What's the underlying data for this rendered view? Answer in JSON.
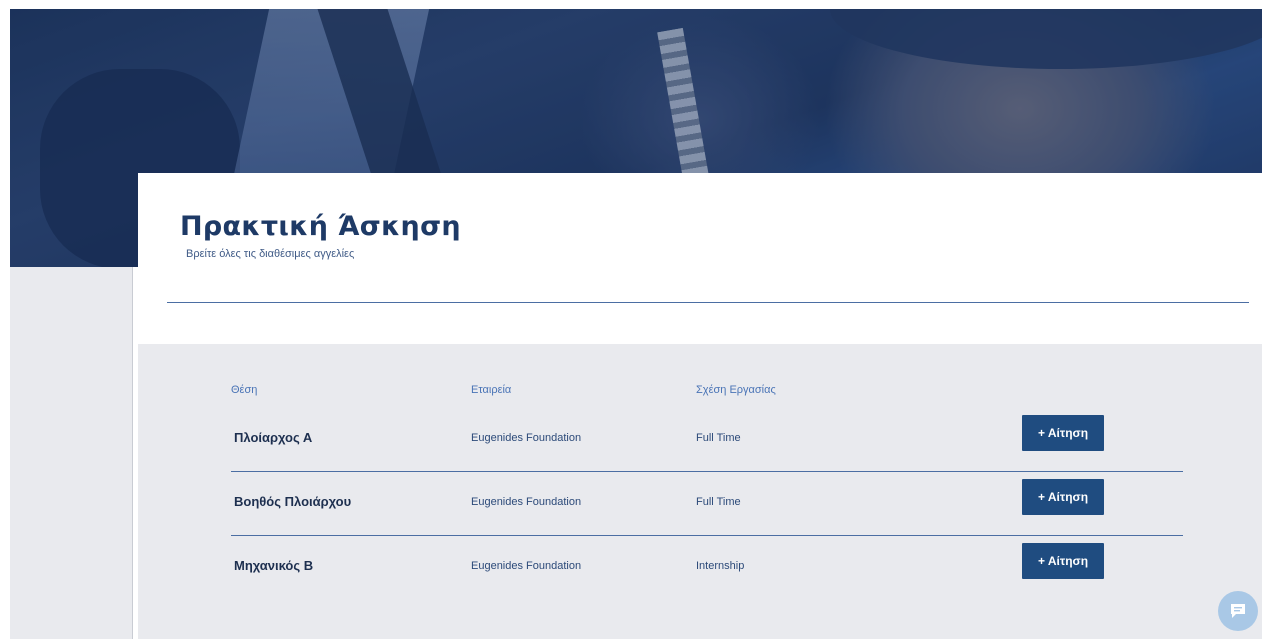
{
  "header": {
    "title": "Πρακτική Άσκηση",
    "subtitle": "Βρείτε όλες τις διαθέσιμες αγγελίες"
  },
  "listing": {
    "columns": [
      "Θέση",
      "Εταιρεία",
      "Σχέση Εργασίας"
    ],
    "rows": [
      {
        "position": "Πλοίαρχος Α",
        "company": "Eugenides Foundation",
        "type": "Full Time",
        "apply": "+ Αίτηση"
      },
      {
        "position": "Βοηθός Πλοιάρχου",
        "company": "Eugenides Foundation",
        "type": "Full Time",
        "apply": "+ Αίτηση"
      },
      {
        "position": "Μηχανικός Β",
        "company": "Eugenides Foundation",
        "type": "Internship",
        "apply": "+ Αίτηση"
      }
    ]
  },
  "icons": {
    "chat": "chat-icon"
  },
  "colors": {
    "accent": "#1f4c80",
    "title": "#1e3a66",
    "panel": "#e9eaee",
    "chat": "#a9c8e6"
  }
}
